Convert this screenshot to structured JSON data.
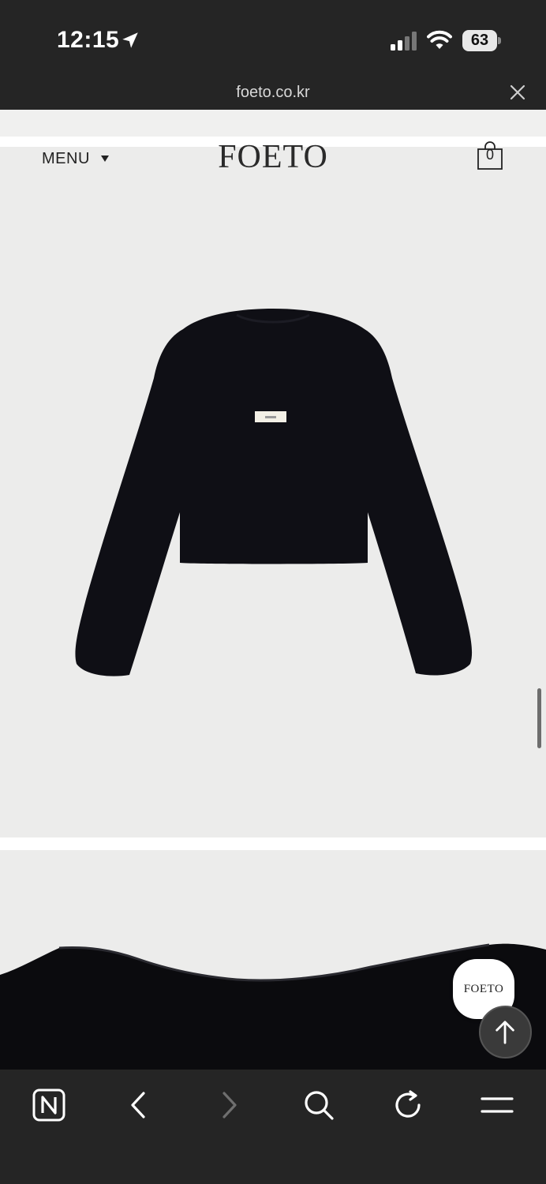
{
  "status_bar": {
    "time": "12:15",
    "battery_level": "63",
    "icons": [
      "location-arrow-icon",
      "cellular-signal-icon",
      "wifi-icon",
      "battery-icon"
    ]
  },
  "browser": {
    "url": "foeto.co.kr",
    "close_icon": "close-icon"
  },
  "header": {
    "menu_label": "MENU",
    "menu_icon": "caret-down-icon",
    "logo": "FOETO",
    "cart_count": "0",
    "cart_icon": "shopping-bag-icon"
  },
  "content": {
    "product_image": "black cropped knit sweater",
    "detail_image": "sweater neckline close-up"
  },
  "floating": {
    "brand_badge": "FOETO",
    "top_button_icon": "arrow-up-icon"
  },
  "bottom_toolbar": {
    "items": [
      {
        "icon": "naver-n-icon"
      },
      {
        "icon": "back-chevron-icon"
      },
      {
        "icon": "forward-chevron-icon"
      },
      {
        "icon": "search-icon"
      },
      {
        "icon": "refresh-icon"
      },
      {
        "icon": "hamburger-menu-icon"
      }
    ]
  },
  "colors": {
    "chrome": "#252525",
    "page_bg": "#ececeb",
    "text_dark": "#222222"
  }
}
